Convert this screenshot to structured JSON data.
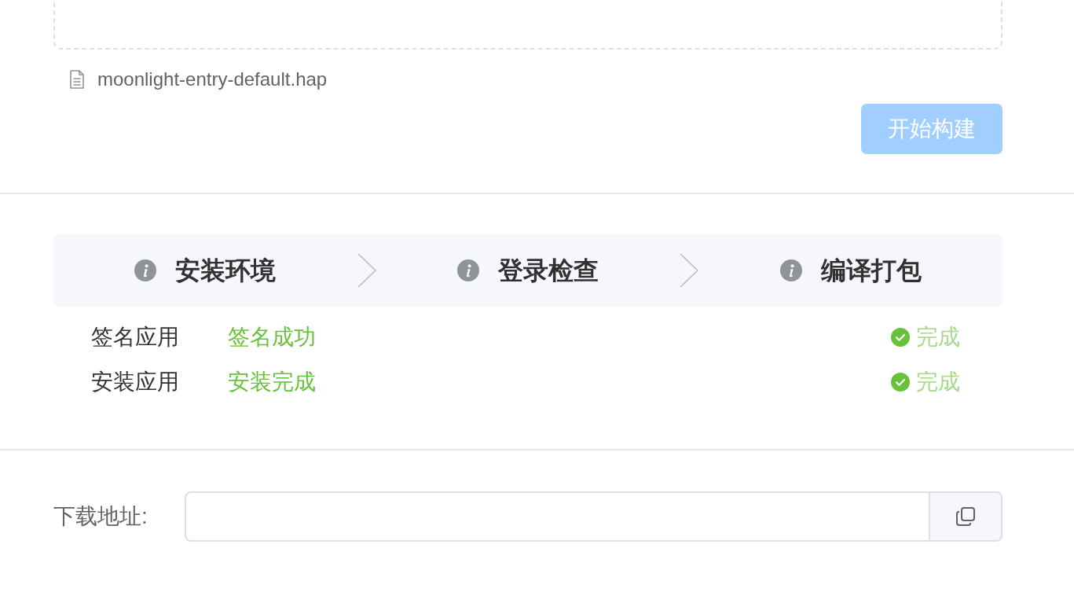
{
  "upload": {
    "files": [
      {
        "name": "moonlight-entry-default.hap"
      }
    ]
  },
  "build_button": {
    "label": "开始构建",
    "disabled": true
  },
  "steps": [
    {
      "title": "安装环境"
    },
    {
      "title": "登录检查"
    },
    {
      "title": "编译打包"
    }
  ],
  "tasks": [
    {
      "name": "签名应用",
      "message": "签名成功",
      "done": true,
      "status_text": "完成"
    },
    {
      "name": "安装应用",
      "message": "安装完成",
      "done": true,
      "status_text": "完成"
    }
  ],
  "download": {
    "label": "下载地址:"
  }
}
